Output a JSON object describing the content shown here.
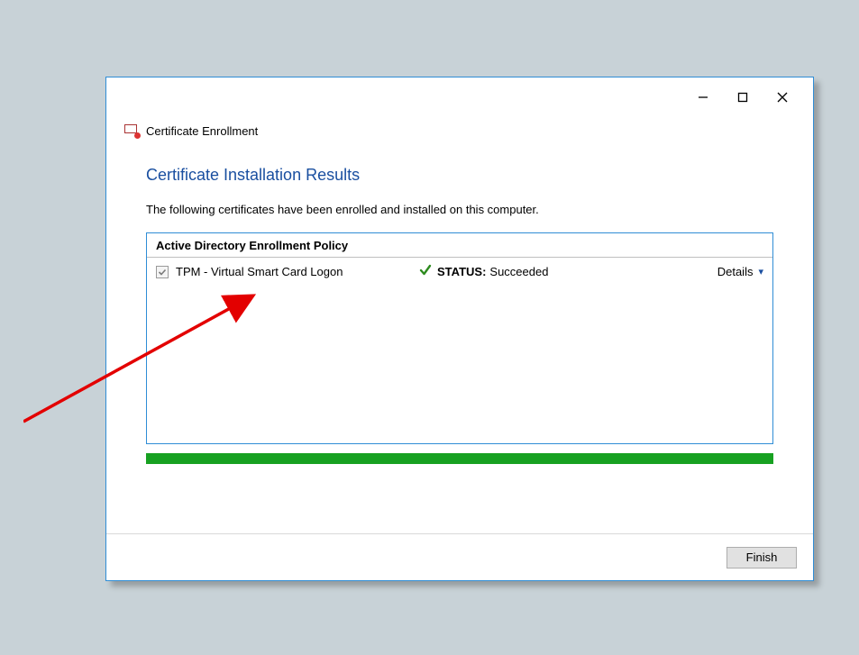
{
  "window": {
    "title": "Certificate Enrollment"
  },
  "main": {
    "heading": "Certificate Installation Results",
    "subtext": "The following certificates have been enrolled and installed on this computer."
  },
  "policy": {
    "header": "Active Directory Enrollment Policy",
    "items": [
      {
        "checked": true,
        "name": "TPM - Virtual Smart Card Logon",
        "status_label": "STATUS:",
        "status_value": "Succeeded",
        "details_label": "Details"
      }
    ]
  },
  "footer": {
    "finish_label": "Finish"
  },
  "colors": {
    "accent_blue": "#2f8dd6",
    "heading_blue": "#1a4fa0",
    "progress_green": "#17a121"
  }
}
